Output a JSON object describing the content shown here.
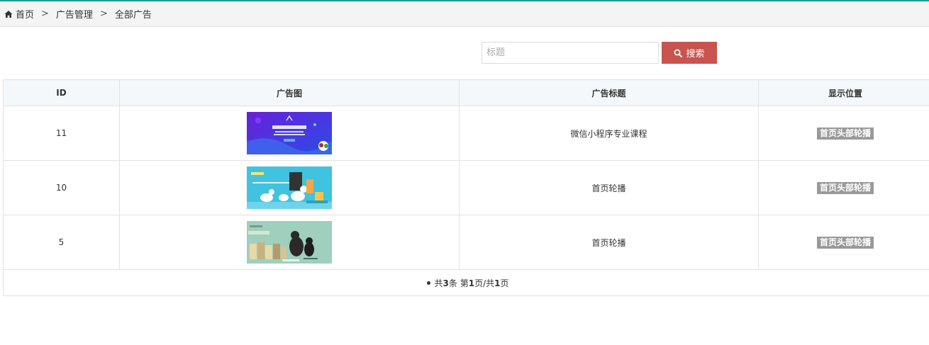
{
  "breadcrumb": {
    "home": "首页",
    "separator": ">",
    "items": [
      "广告管理",
      "全部广告"
    ]
  },
  "search": {
    "placeholder": "标题",
    "value": "",
    "button_label": "搜索"
  },
  "table": {
    "headers": [
      "ID",
      "广告图",
      "广告标题",
      "显示位置"
    ],
    "rows": [
      {
        "id": "11",
        "title": "微信小程序专业课程",
        "position": "首页头部轮播"
      },
      {
        "id": "10",
        "title": "首页轮播",
        "position": "首页头部轮播"
      },
      {
        "id": "5",
        "title": "首页轮播",
        "position": "首页头部轮播"
      }
    ]
  },
  "pagination": {
    "prefix": "共",
    "total": "3",
    "unit": "条 第",
    "page": "1",
    "mid": "页/共",
    "pages": "1",
    "suffix": "页"
  },
  "colors": {
    "accent_line": "#1aa094",
    "search_button": "#c9534f",
    "badge": "#999999",
    "table_header_bg": "#f4f8fb"
  }
}
